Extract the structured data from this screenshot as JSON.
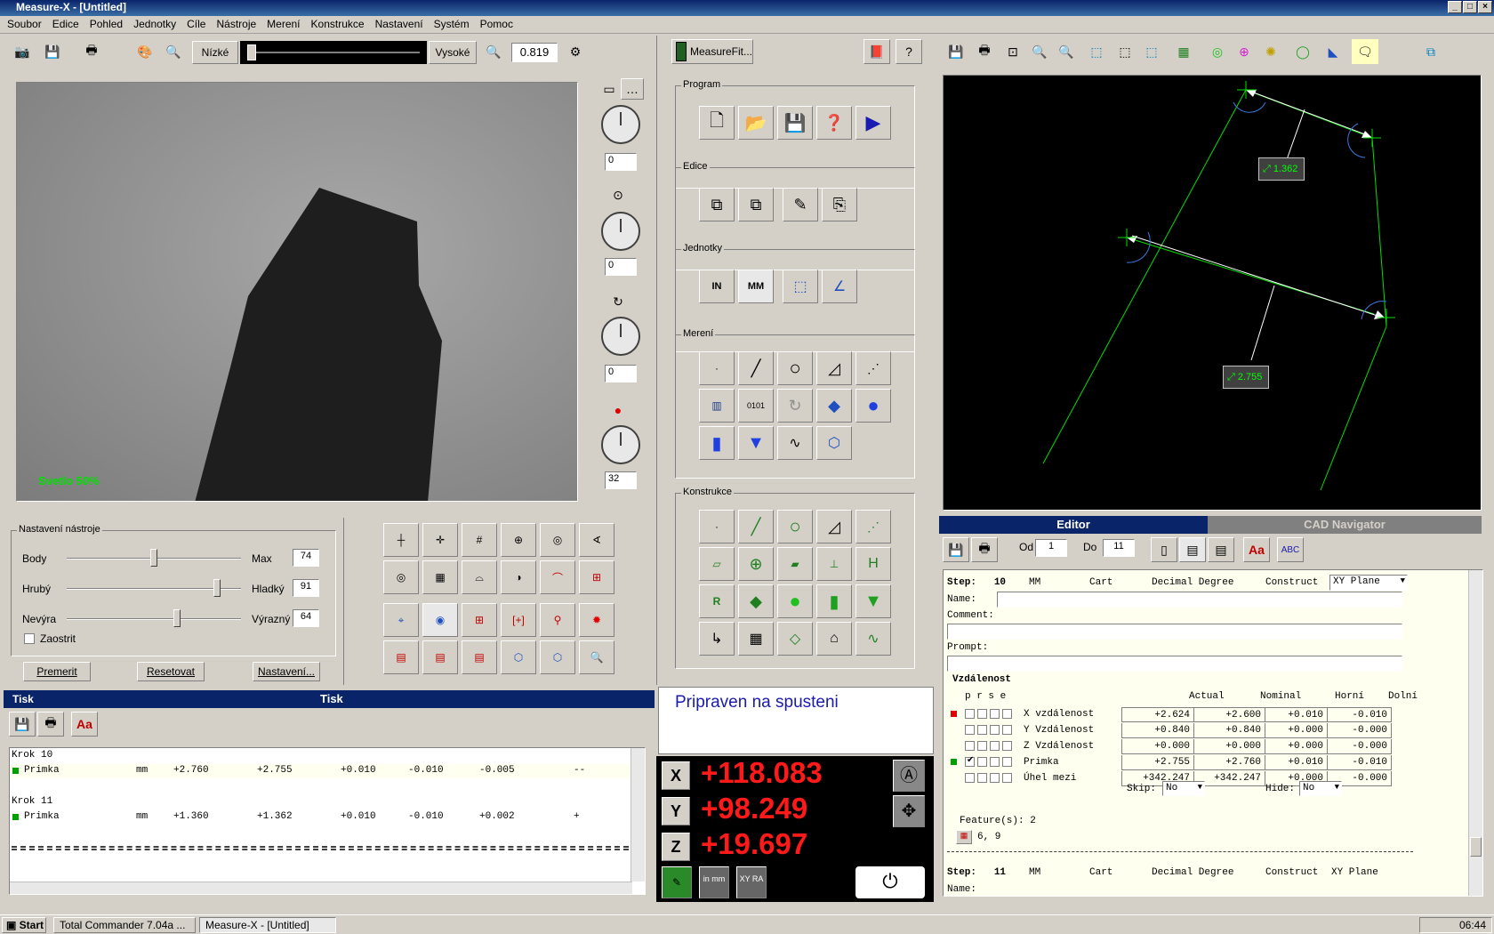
{
  "window": {
    "title": "Measure-X - [Untitled]"
  },
  "menu": [
    "Soubor",
    "Edice",
    "Pohled",
    "Jednotky",
    "Cíle",
    "Nástroje",
    "Merení",
    "Konstrukce",
    "Nastavení",
    "Systém",
    "Pomoc"
  ],
  "camera_toolbar": {
    "low_label": "Nízké",
    "high_label": "Vysoké",
    "zoom_value": "0.819"
  },
  "camera": {
    "light_text": "Svetlo  50%"
  },
  "side_controls": {
    "values": [
      "0",
      "0",
      "0",
      "32"
    ]
  },
  "tool_settings": {
    "title": "Nastavení nástroje",
    "rows": [
      {
        "left": "Body",
        "right": "Max",
        "value": "74",
        "thumb": 0.5
      },
      {
        "left": "Hrubý",
        "right": "Hladký",
        "value": "91",
        "thumb": 0.88
      },
      {
        "left": "Nevýra",
        "right": "Výrazný",
        "value": "64",
        "thumb": 0.64
      }
    ],
    "focus_label": "Zaostrit",
    "buttons": [
      "Premerit",
      "Resetovat",
      "Nastavení..."
    ]
  },
  "print_panel": {
    "tab_label": "Tisk",
    "header": "Tisk",
    "steps": [
      {
        "title": "Krok 10",
        "name": "Primka",
        "unit": "mm",
        "v1": "+2.760",
        "v2": "+2.755",
        "v3": "+0.010",
        "v4": "-0.010",
        "v5": "-0.005",
        "v6": "--"
      },
      {
        "title": "Krok 11",
        "name": "Primka",
        "unit": "mm",
        "v1": "+1.360",
        "v2": "+1.362",
        "v3": "+0.010",
        "v4": "-0.010",
        "v5": "+0.002",
        "v6": "+"
      }
    ]
  },
  "program_panel": {
    "measurefit_label": "MeasureFit...",
    "groups": [
      "Program",
      "Edice",
      "Jednotky",
      "Merení",
      "Konstrukce"
    ],
    "status": "Pripraven na spusteni"
  },
  "dro": {
    "x_label": "X",
    "x_value": "+118.083",
    "y_label": "Y",
    "y_value": "+98.249",
    "z_label": "Z",
    "z_value": "+19.697",
    "unit_btn": "in mm",
    "ra_btn": "XY RA"
  },
  "cad": {
    "labels": [
      {
        "text": "1.362"
      },
      {
        "text": "2.755"
      }
    ],
    "color": "#00ff00"
  },
  "editor": {
    "tab_editor": "Editor",
    "tab_cad": "CAD Navigator",
    "od_label": "Od",
    "od_value": "1",
    "do_label": "Do",
    "do_value": "11",
    "step10": {
      "step": "Step:",
      "num": "10",
      "unit": "MM",
      "coord": "Cart",
      "angle": "Decimal Degree",
      "type": "Construct",
      "plane": "XY Plane"
    },
    "name_label": "Name:",
    "comment_label": "Comment:",
    "prompt_label": "Prompt:",
    "section": "Vzdálenost",
    "flags": "p r s e",
    "cols": [
      "Actual",
      "Nominal",
      "Horní",
      "Dolní"
    ],
    "rows": [
      {
        "name": "X vzdálenost",
        "vals": [
          "+2.624",
          "+2.600",
          "+0.010",
          "-0.010"
        ],
        "mark": "#e00000",
        "checked": false
      },
      {
        "name": "Y Vzdálenost",
        "vals": [
          "+0.840",
          "+0.840",
          "+0.000",
          "-0.000"
        ],
        "mark": "",
        "checked": false
      },
      {
        "name": "Z Vzdálenost",
        "vals": [
          "+0.000",
          "+0.000",
          "+0.000",
          "-0.000"
        ],
        "mark": "",
        "checked": false
      },
      {
        "name": "Primka",
        "vals": [
          "+2.755",
          "+2.760",
          "+0.010",
          "-0.010"
        ],
        "mark": "#00a000",
        "checked": true
      },
      {
        "name": "Úhel mezi",
        "vals": [
          "+342.247",
          "+342.247",
          "+0.000",
          "-0.000"
        ],
        "mark": "",
        "checked": false
      }
    ],
    "skip_label": "Skip:",
    "skip_value": "No",
    "hide_label": "Hide:",
    "hide_value": "No",
    "features": "Feature(s): 2",
    "feature_ids": "6, 9",
    "step11": {
      "step": "Step:",
      "num": "11",
      "unit": "MM",
      "coord": "Cart",
      "angle": "Decimal Degree",
      "type": "Construct",
      "plane": "XY Plane"
    }
  },
  "taskbar": {
    "start": "Start",
    "items": [
      "Total Commander 7.04a ...",
      "Measure-X - [Untitled]"
    ],
    "clock": "06:44"
  }
}
